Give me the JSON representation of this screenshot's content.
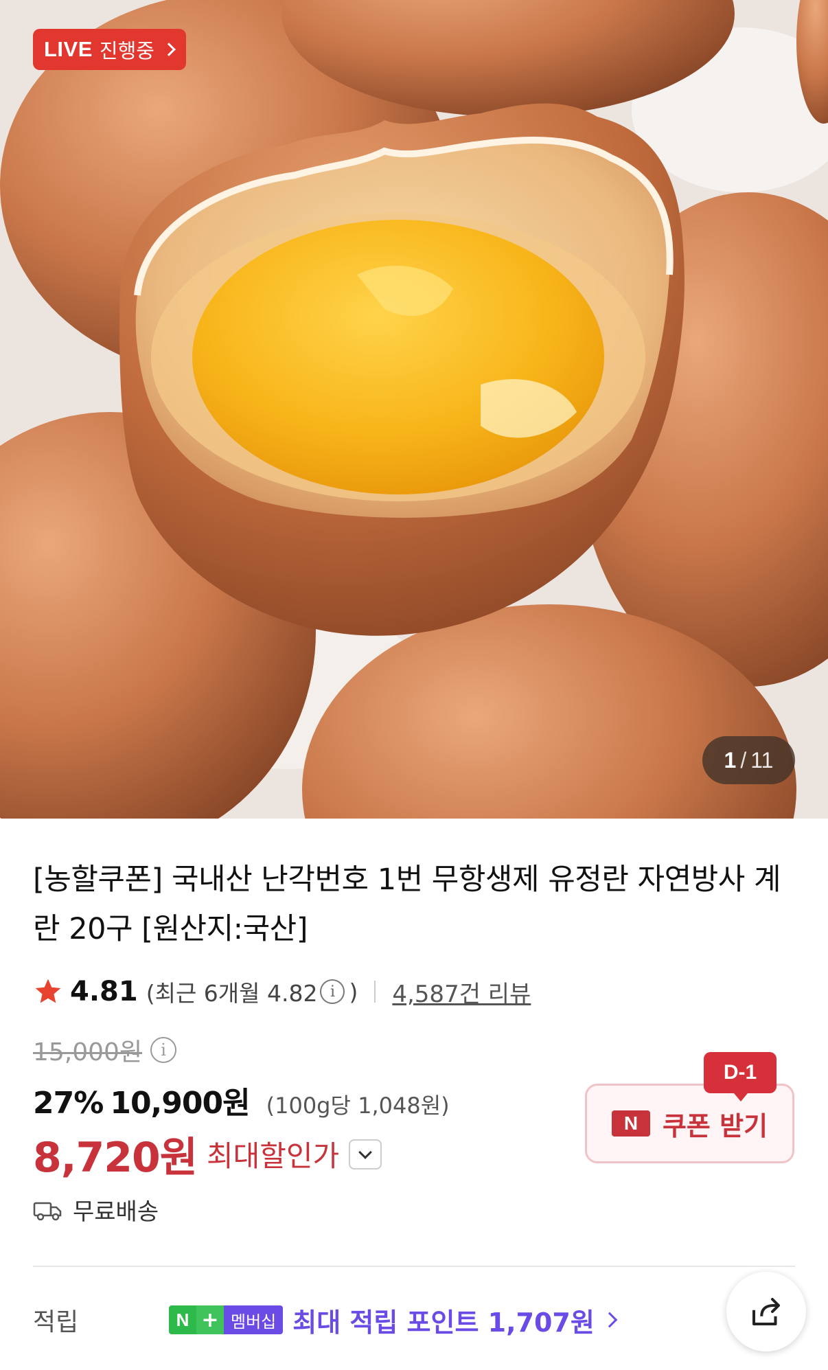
{
  "hero": {
    "live_label": "LIVE",
    "live_status": "진행중",
    "counter_current": "1",
    "counter_separator": "/",
    "counter_total": "11"
  },
  "product": {
    "title": "[농할쿠폰] 국내산 난각번호 1번 무항생제 유정란 자연방사 계란 20구 [원산지:국산]"
  },
  "rating": {
    "score": "4.81",
    "recent_text": "(최근 6개월 4.82",
    "recent_close": ")",
    "info_symbol": "i",
    "review_count": "4,587건 리뷰"
  },
  "price": {
    "original": "15,000원",
    "info_symbol": "i",
    "discount_pct": "27%",
    "sale_price": "10,900원",
    "unit_price": "(100g당 1,048원)",
    "final_price": "8,720원",
    "final_label": "최대할인가"
  },
  "coupon": {
    "dday": "D-1",
    "npay_letter": "N",
    "label": "쿠폰 받기"
  },
  "shipping": {
    "label": "무료배송"
  },
  "points": {
    "label": "적립",
    "badge_n": "N",
    "badge_plus": "+",
    "badge_text": "멤버십",
    "text": "최대 적립 포인트 1,707원"
  },
  "colors": {
    "accent_red": "#c8323a",
    "live_red": "#e2372e",
    "membership_purple": "#6a4be6",
    "membership_green": "#2eb94b"
  },
  "icons": [
    "star-icon",
    "info-icon",
    "chevron-down-icon",
    "truck-icon",
    "chevron-right-icon",
    "share-icon"
  ]
}
